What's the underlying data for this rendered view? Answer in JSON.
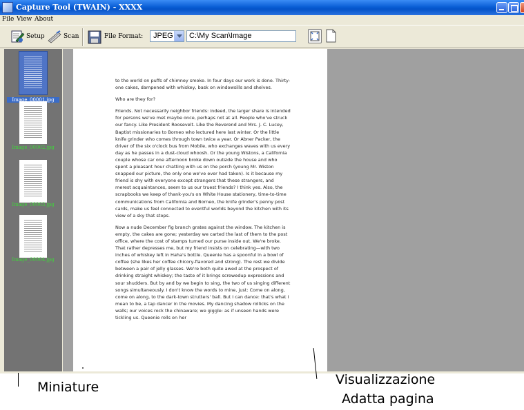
{
  "window": {
    "title": "Capture Tool (TWAIN) - XXXX"
  },
  "menu": {
    "items": [
      "File",
      "View",
      "About"
    ]
  },
  "toolbar": {
    "setup_label": "Setup",
    "scan_label": "Scan",
    "file_format_label": "File Format:",
    "file_format_value": "JPEG",
    "path_value": "C:\\My Scan\\Image"
  },
  "thumbnails": {
    "items": [
      {
        "label": "Image_00001.jpg",
        "selected": true
      },
      {
        "label": "Image_00002.jpg",
        "selected": false
      },
      {
        "label": "Image_00003.jpg",
        "selected": false
      },
      {
        "label": "Image_00004.jpg",
        "selected": false
      }
    ]
  },
  "document": {
    "paragraphs": [
      "to the world on puffs of chimney smoke. In four days our work is done. Thirty-one cakes, dampened with whiskey, bask on windowsills and shelves.",
      "Who are they for?",
      "Friends. Not necessarily neighbor friends: indeed, the larger share is intended for persons we've met maybe once, perhaps not at all. People who've struck our fancy. Like President Roosevelt. Like the Reverend and Mrs. J. C. Lucey, Baptist missionaries to Borneo who lectured here last winter. Or the little knife grinder who comes through town twice a year. Or Abner Packer, the driver of the six o'clock bus from Mobile, who exchanges waves with us every day as he passes in a dust-cloud whoosh. Or the young Wistons, a California couple whose car one afternoon broke down outside the house and who spent a pleasant hour chatting with us on the porch (young Mr. Wiston snapped our picture, the only one we've ever had taken). Is it because my friend is shy with everyone except strangers that these strangers, and merest acquaintances, seem to us our truest friends? I think yes. Also, the scrapbooks we keep of thank-you's on White House stationery, time-to-time communications from California and Borneo, the knife grinder's penny post cards, make us feel connected to eventful worlds beyond the kitchen with its view of a sky that stops.",
      "Now a nude December fig branch grates against the window. The kitchen is empty, the cakes are gone; yesterday we carted the last of them to the post office, where the cost of stamps turned our purse inside out. We're broke. That rather depresses me, but my friend insists on celebrating—with two inches of whiskey left in Haha's bottle. Queenie has a spoonful in a bowl of coffee (she likes her coffee chicory-flavored and strong). The rest we divide between a pair of jelly glasses. We're both quite awed at the prospect of drinking straight whiskey; the taste of it brings screwedup expressions and sour shudders. But by and by we begin to sing, the two of us singing different songs simultaneously. I don't know the words to mine, just: Come on along, come on along, to the dark-town strutters' ball. But I can dance: that's what I mean to be, a tap dancer in the movies. My dancing shadow rollicks on the walls; our voices rock the chinaware; we giggle: as if unseen hands were tickling us. Queenie rolls on her"
    ]
  },
  "annotations": {
    "thumbnails_caption": "Miniature",
    "view_caption_line1": "Visualizzazione",
    "view_caption_line2": "Adatta pagina"
  },
  "colors": {
    "titlebar": "#0a5fd6",
    "thumbnail_pane": "#737373",
    "view_pane": "#a0a0a0",
    "thumbnail_label_green": "#3fd63a"
  }
}
